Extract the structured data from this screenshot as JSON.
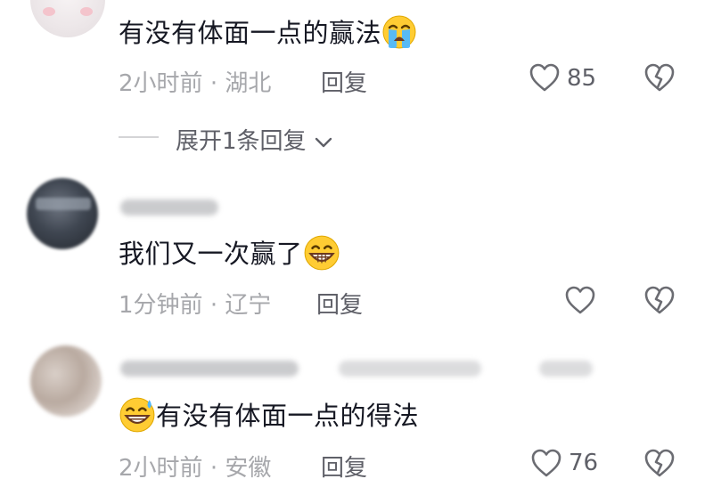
{
  "comments": [
    {
      "text": "有没有体面一点的赢法",
      "emoji": "loudly-crying-face",
      "time": "2小时前",
      "separator": "·",
      "location": "湖北",
      "reply_label": "回复",
      "likes": "85",
      "expand_label": "展开1条回复"
    },
    {
      "text": "我们又一次赢了",
      "emoji": "grinning-face",
      "time": "1分钟前",
      "separator": "·",
      "location": "辽宁",
      "reply_label": "回复",
      "likes": ""
    },
    {
      "text": "有没有体面一点的得法",
      "emoji": "grinning-face-with-sweat",
      "time": "2小时前",
      "separator": "·",
      "location": "安徽",
      "reply_label": "回复",
      "likes": "76"
    }
  ],
  "colors": {
    "text": "#161823",
    "meta": "#a6a7ab",
    "secondary": "#5f6068",
    "icon": "#6b6c72"
  },
  "icons": [
    "heart-icon",
    "broken-heart-icon",
    "chevron-down-icon"
  ]
}
